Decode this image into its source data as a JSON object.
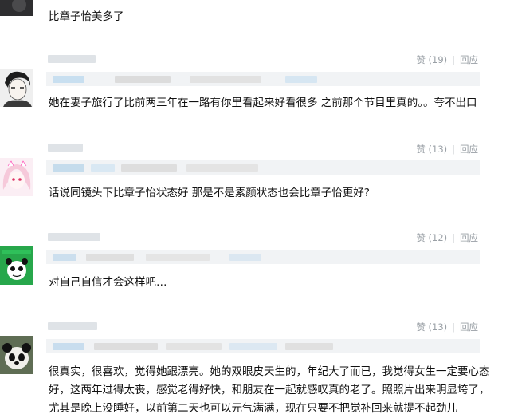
{
  "comments": [
    {
      "text": "比章子怡美多了",
      "avatar_icon": "dark-avatar-icon"
    },
    {
      "likes": "赞 (19)",
      "reply": "回应",
      "text": "她在妻子旅行了比前两三年在一路有你里看起来好看很多 之前那个节目里真的。。夸不出口",
      "avatar_icon": "manga-portrait-avatar-icon"
    },
    {
      "likes": "赞 (13)",
      "reply": "回应",
      "text": "话说同镜头下比章子怡状态好 那是不是素颜状态也会比章子怡更好?",
      "avatar_icon": "anime-girl-avatar-icon"
    },
    {
      "likes": "赞 (12)",
      "reply": "回应",
      "text": "对自己自信才会这样吧…",
      "avatar_icon": "green-panda-sticker-avatar-icon"
    },
    {
      "likes": "赞 (13)",
      "reply": "回应",
      "text": "很真实，很喜欢，觉得她跟漂亮。她的双眼皮天生的，年纪大了而已，我觉得女生一定要心态好，这两年过得太丧，感觉老得好快，和朋友在一起就感叹真的老了。照照片出来明显垮了，尤其是晚上没睡好，以前第二天也可以元气满满，现在只要不把觉补回来就提不起劲儿",
      "avatar_icon": "panda-photo-avatar-icon"
    }
  ]
}
